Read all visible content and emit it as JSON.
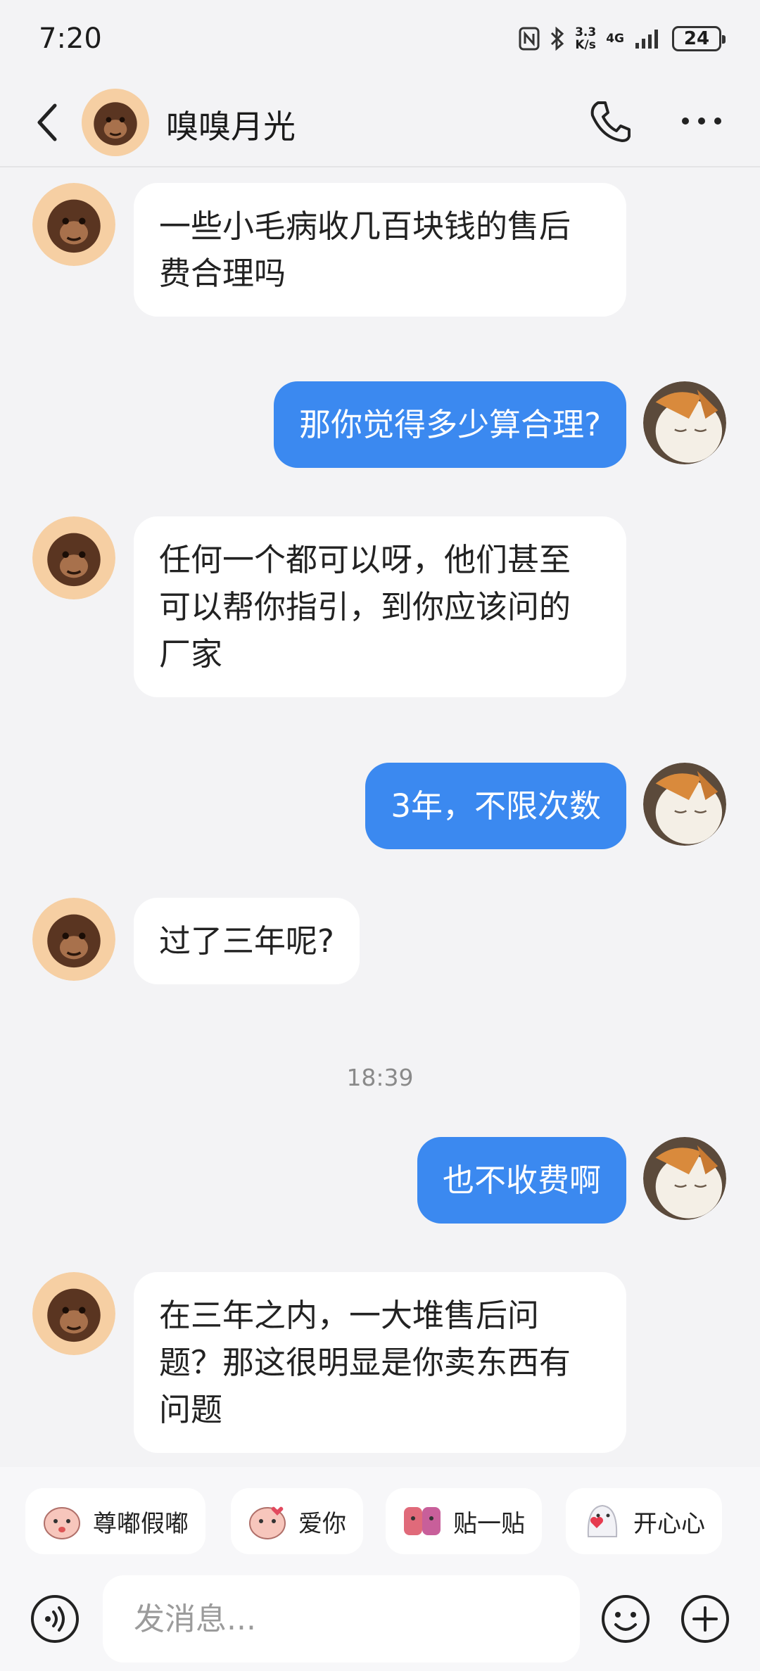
{
  "status_bar": {
    "time": "7:20",
    "net_speed_top": "3.3",
    "net_speed_bottom": "K/s",
    "network": "4G",
    "battery": "24"
  },
  "header": {
    "title": "嗅嗅月光",
    "back_icon": "chevron-left-icon",
    "call_icon": "phone-icon",
    "more_icon": "more-dots-icon"
  },
  "messages": [
    {
      "side": "in",
      "text": "一些小毛病收几百块钱的售后费合理吗"
    },
    {
      "side": "out",
      "text": "那你觉得多少算合理?"
    },
    {
      "side": "in",
      "text": "任何一个都可以呀，他们甚至可以帮你指引，到你应该问的厂家"
    },
    {
      "side": "out",
      "text": "3年，不限次数"
    },
    {
      "side": "in",
      "text": "过了三年呢?"
    },
    {
      "side": "out",
      "text": "也不收费啊"
    },
    {
      "side": "in",
      "text": "在三年之内，一大堆售后问题？那这很明显是你卖东西有问题"
    }
  ],
  "timestamp": "18:39",
  "quick_stickers": [
    {
      "label": "尊嘟假嘟"
    },
    {
      "label": "爱你"
    },
    {
      "label": "贴一贴"
    },
    {
      "label": "开心心"
    }
  ],
  "input": {
    "placeholder": "发消息..."
  },
  "colors": {
    "outgoing_bubble": "#3b89f0",
    "incoming_bubble": "#ffffff",
    "background": "#f3f3f5"
  }
}
